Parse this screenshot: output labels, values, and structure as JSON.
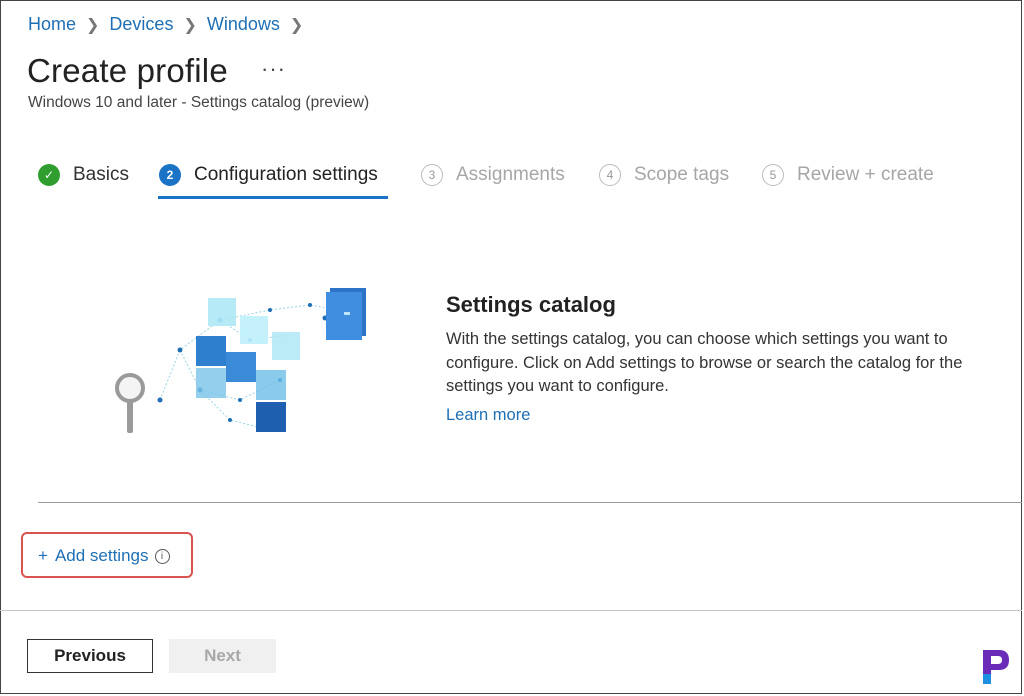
{
  "breadcrumb": [
    "Home",
    "Devices",
    "Windows"
  ],
  "page": {
    "title": "Create profile",
    "more": "···",
    "subtitle": "Windows 10 and later - Settings catalog (preview)"
  },
  "steps": [
    {
      "num": "✓",
      "label": "Basics",
      "state": "done"
    },
    {
      "num": "2",
      "label": "Configuration settings",
      "state": "active"
    },
    {
      "num": "3",
      "label": "Assignments",
      "state": "todo"
    },
    {
      "num": "4",
      "label": "Scope tags",
      "state": "todo"
    },
    {
      "num": "5",
      "label": "Review + create",
      "state": "todo"
    }
  ],
  "catalog": {
    "title": "Settings catalog",
    "description": "With the settings catalog, you can choose which settings you want to configure. Click on Add settings to browse or search the catalog for the settings you want to configure.",
    "learn_more": "Learn more"
  },
  "add_settings": {
    "plus": "+",
    "label": "Add settings",
    "info": "i"
  },
  "footer": {
    "previous": "Previous",
    "next": "Next"
  },
  "logo": {
    "letter": "P"
  },
  "colors": {
    "accent": "#1a73c5",
    "success": "#2f9e2f",
    "highlight": "#d9534f",
    "link": "#1f6fb5"
  }
}
